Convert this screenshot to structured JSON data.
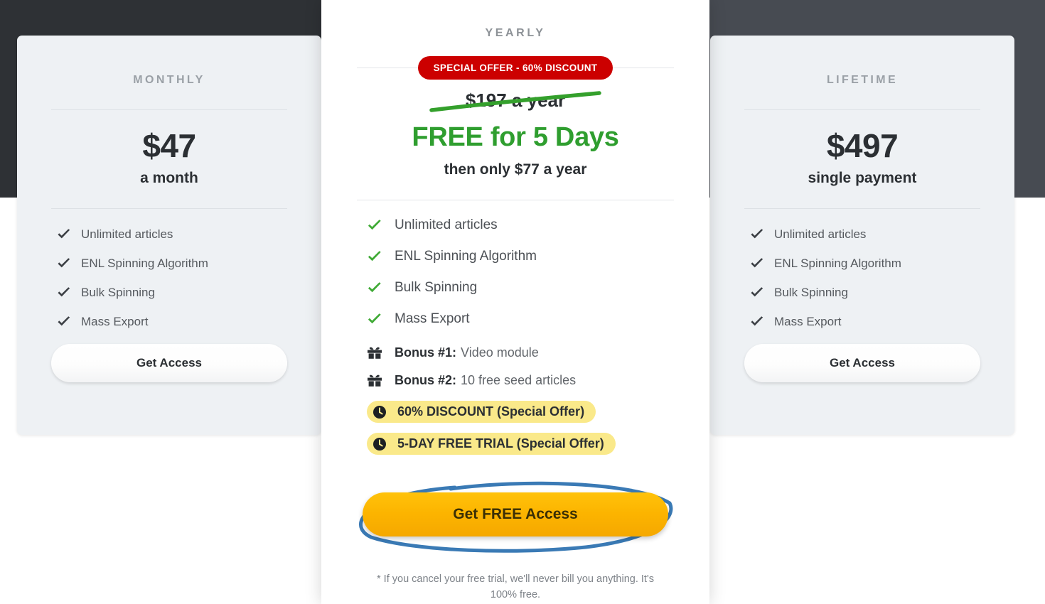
{
  "plans": {
    "monthly": {
      "name": "MONTHLY",
      "price": "$47",
      "period": "a month",
      "features": [
        "Unlimited articles",
        "ENL Spinning Algorithm",
        "Bulk Spinning",
        "Mass Export"
      ],
      "cta": "Get Access"
    },
    "yearly": {
      "name": "YEARLY",
      "offer_badge": "SPECIAL OFFER - 60% DISCOUNT",
      "old_price": "$197 a year",
      "headline": "FREE for 5 Days",
      "then_only": "then only $77 a year",
      "features": [
        "Unlimited articles",
        "ENL Spinning Algorithm",
        "Bulk Spinning",
        "Mass Export"
      ],
      "bonuses": [
        {
          "label": "Bonus #1:",
          "text": "Video module"
        },
        {
          "label": "Bonus #2:",
          "text": "10 free seed articles"
        }
      ],
      "highlights": [
        "60% DISCOUNT (Special Offer)",
        "5-DAY FREE TRIAL (Special Offer)"
      ],
      "cta": "Get FREE Access",
      "footnote": "* If you cancel your free trial, we'll never bill you anything. It's 100% free."
    },
    "lifetime": {
      "name": "LIFETIME",
      "price": "$497",
      "period": "single payment",
      "features": [
        "Unlimited articles",
        "ENL Spinning Algorithm",
        "Bulk Spinning",
        "Mass Export"
      ],
      "cta": "Get Access"
    }
  },
  "icons": {
    "check": "check-icon",
    "gift": "gift-icon",
    "clock": "clock-icon",
    "strike": "strikethrough-annotation",
    "circle": "hand-drawn-circle-annotation"
  },
  "colors": {
    "offer_red": "#cc0000",
    "free_green": "#2f9e2f",
    "cta_orange": "#fcb400",
    "highlight_yellow": "#fae98a",
    "annotation_blue": "#3a7ab5",
    "card_bg": "#eef1f4",
    "backdrop_dark": "#2e3135"
  }
}
